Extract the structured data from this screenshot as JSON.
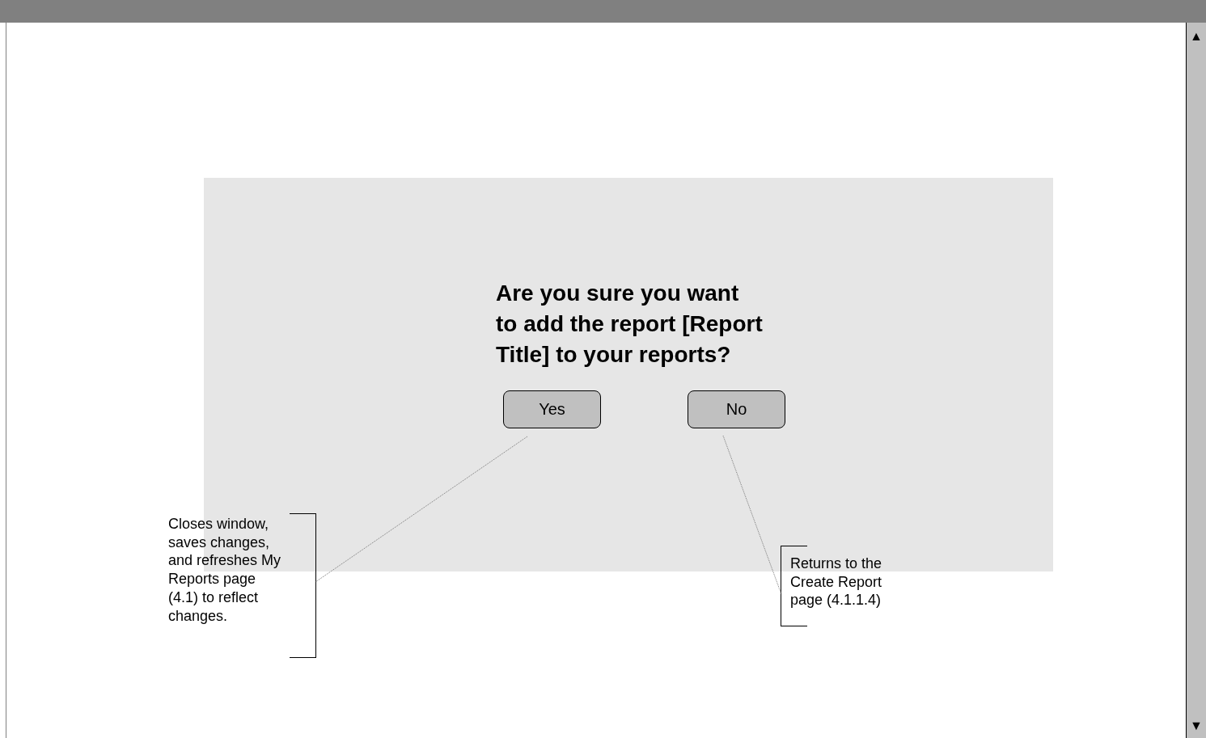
{
  "dialog": {
    "question": [
      "Are you sure you want",
      "to add the report [Report",
      "Title] to your reports?"
    ],
    "buttons": [
      {
        "label": "Yes"
      },
      {
        "label": "No"
      }
    ]
  },
  "annotations": [
    {
      "lines": [
        "Closes window,",
        "saves changes,",
        "and refreshes My",
        "Reports page",
        "(4.1) to reflect",
        "changes."
      ],
      "kind": "right"
    },
    {
      "lines": [
        "Returns to the",
        "Create Report",
        "page (4.1.1.4)"
      ],
      "kind": "left"
    }
  ],
  "scrollbar": {
    "up": "▲",
    "down": "▼"
  }
}
